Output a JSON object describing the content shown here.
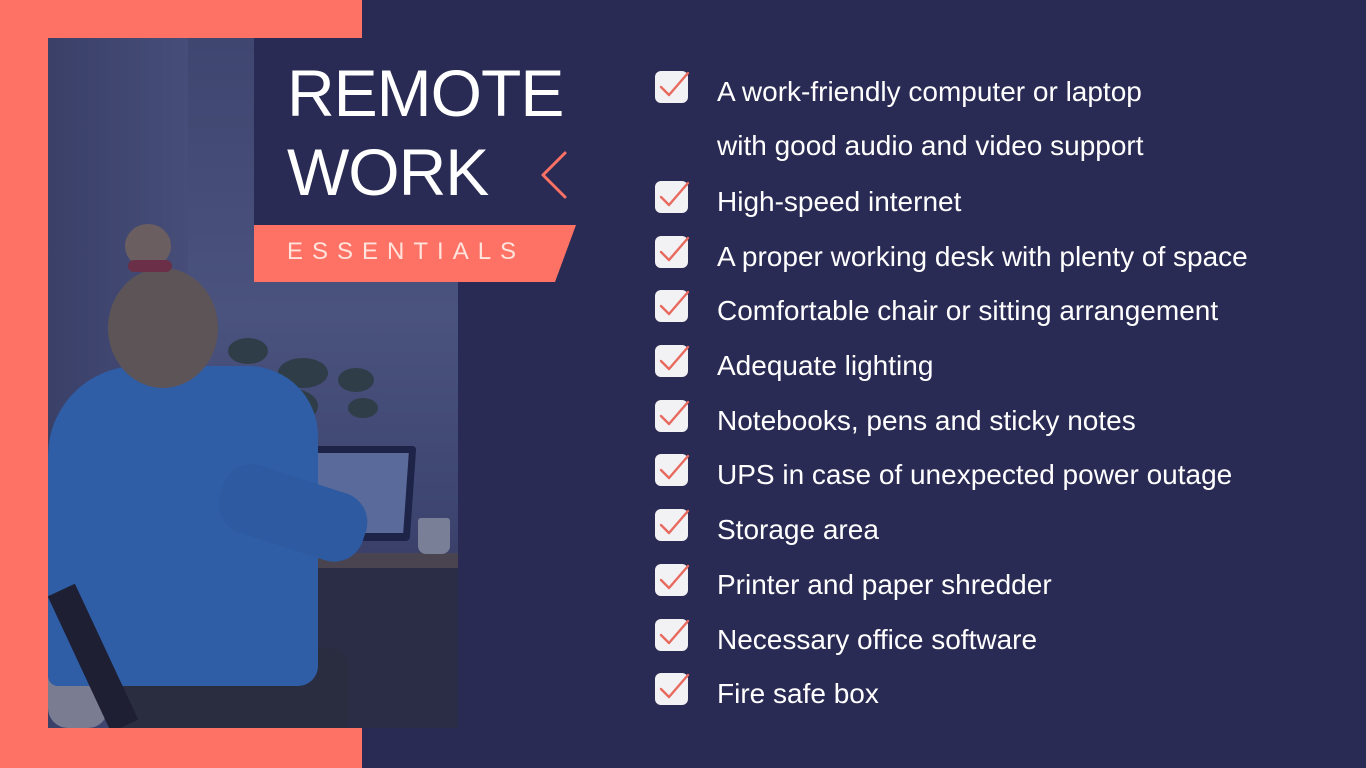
{
  "title": {
    "line1": "REMOTE",
    "line2": "WORK",
    "subtitle": "ESSENTIALS"
  },
  "colors": {
    "background": "#2a2b54",
    "accent": "#fd7264",
    "text": "#ffffff",
    "checkbox_fill": "#f2f1f4",
    "checkmark": "#e86a5e"
  },
  "icons": {
    "checkbox": "checked-checkbox-icon",
    "chevron": "chevron-left-icon"
  },
  "checklist": [
    {
      "lines": [
        "A work-friendly computer or laptop",
        "with good audio and video support"
      ],
      "checked": true
    },
    {
      "lines": [
        "High-speed internet"
      ],
      "checked": true
    },
    {
      "lines": [
        "A proper working desk with plenty of space"
      ],
      "checked": true
    },
    {
      "lines": [
        "Comfortable chair or sitting arrangement"
      ],
      "checked": true
    },
    {
      "lines": [
        "Adequate lighting"
      ],
      "checked": true
    },
    {
      "lines": [
        "Notebooks, pens and sticky notes"
      ],
      "checked": true
    },
    {
      "lines": [
        "UPS in case of unexpected power outage"
      ],
      "checked": true
    },
    {
      "lines": [
        "Storage area"
      ],
      "checked": true
    },
    {
      "lines": [
        "Printer and paper shredder"
      ],
      "checked": true
    },
    {
      "lines": [
        "Necessary office software"
      ],
      "checked": true
    },
    {
      "lines": [
        "Fire safe box"
      ],
      "checked": true
    }
  ]
}
